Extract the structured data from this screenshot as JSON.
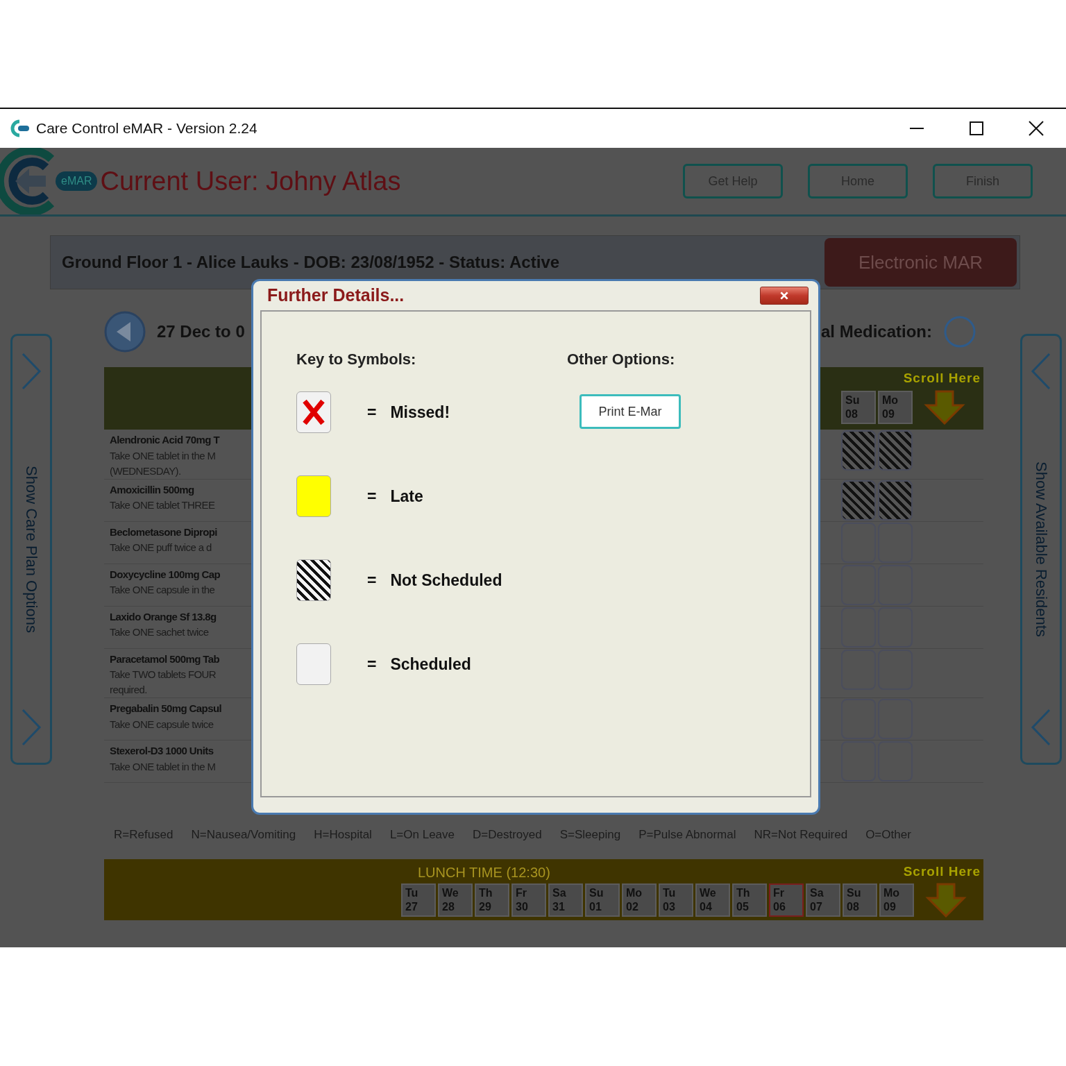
{
  "window": {
    "title": "Care Control eMAR - Version 2.24"
  },
  "header": {
    "badge": "eMAR",
    "current_user": "Current User: Johny Atlas",
    "buttons": [
      "Get Help",
      "Home",
      "Finish"
    ]
  },
  "banner": {
    "text": "Ground Floor 1 - Alice Lauks - DOB: 23/08/1952 - Status: Active",
    "mode_button": "Electronic MAR"
  },
  "left_panel": {
    "label": "Show Care Plan Options"
  },
  "right_panel": {
    "label": "Show Available Residents"
  },
  "date_range": "27 Dec to 0",
  "medication_filter": {
    "label": "al Medication:",
    "checked": false
  },
  "morning_grid": {
    "scroll_label": "Scroll Here",
    "days": [
      {
        "day": "Su",
        "date": "08",
        "selected": false
      },
      {
        "day": "Mo",
        "date": "09",
        "selected": false
      }
    ],
    "medications": [
      {
        "name": "Alendronic Acid 70mg T",
        "lines": [
          "Take ONE tablet in the M",
          "(WEDNESDAY)."
        ],
        "cells": [
          {
            "kind": "not_scheduled"
          },
          {
            "kind": "not_scheduled"
          }
        ]
      },
      {
        "name": "Amoxicillin 500mg",
        "lines": [
          "Take ONE tablet THREE"
        ],
        "cells": [
          {
            "kind": "not_scheduled"
          },
          {
            "kind": "not_scheduled"
          }
        ]
      },
      {
        "name": "Beclometasone Dipropi",
        "lines": [
          "Take ONE puff twice a d"
        ],
        "cells": [
          {
            "kind": "scheduled"
          },
          {
            "kind": "scheduled"
          }
        ]
      },
      {
        "name": "Doxycycline 100mg Cap",
        "lines": [
          "Take ONE capsule in the"
        ],
        "cells": [
          {
            "kind": "scheduled"
          },
          {
            "kind": "scheduled"
          }
        ]
      },
      {
        "name": "Laxido Orange Sf 13.8g",
        "lines": [
          "Take ONE sachet twice"
        ],
        "cells": [
          {
            "kind": "scheduled"
          },
          {
            "kind": "scheduled"
          }
        ]
      },
      {
        "name": "Paracetamol 500mg Tab",
        "lines": [
          "Take TWO tablets FOUR",
          "required."
        ],
        "cells": [
          {
            "kind": "scheduled"
          },
          {
            "kind": "scheduled"
          }
        ]
      },
      {
        "name": "Pregabalin 50mg Capsul",
        "lines": [
          "Take ONE capsule twice"
        ],
        "cells": [
          {
            "kind": "scheduled"
          },
          {
            "kind": "scheduled"
          }
        ]
      },
      {
        "name": "Stexerol-D3 1000 Units",
        "lines": [
          "Take ONE tablet in the M"
        ],
        "cells": [
          {
            "kind": "scheduled"
          },
          {
            "kind": "scheduled"
          }
        ]
      }
    ]
  },
  "legend": [
    "R=Refused",
    "N=Nausea/Vomiting",
    "H=Hospital",
    "L=On Leave",
    "D=Destroyed",
    "S=Sleeping",
    "P=Pulse Abnormal",
    "NR=Not Required",
    "O=Other"
  ],
  "lunch_grid": {
    "title": "LUNCH TIME (12:30)",
    "scroll_label": "Scroll Here",
    "days": [
      {
        "day": "Tu",
        "date": "27",
        "selected": false
      },
      {
        "day": "We",
        "date": "28",
        "selected": false
      },
      {
        "day": "Th",
        "date": "29",
        "selected": false
      },
      {
        "day": "Fr",
        "date": "30",
        "selected": false
      },
      {
        "day": "Sa",
        "date": "31",
        "selected": false
      },
      {
        "day": "Su",
        "date": "01",
        "selected": false
      },
      {
        "day": "Mo",
        "date": "02",
        "selected": false
      },
      {
        "day": "Tu",
        "date": "03",
        "selected": false
      },
      {
        "day": "We",
        "date": "04",
        "selected": false
      },
      {
        "day": "Th",
        "date": "05",
        "selected": false
      },
      {
        "day": "Fr",
        "date": "06",
        "selected": true
      },
      {
        "day": "Sa",
        "date": "07",
        "selected": false
      },
      {
        "day": "Su",
        "date": "08",
        "selected": false
      },
      {
        "day": "Mo",
        "date": "09",
        "selected": false
      }
    ]
  },
  "dialog": {
    "title": "Further Details...",
    "key_heading": "Key to Symbols:",
    "options_heading": "Other Options:",
    "symbols": [
      {
        "kind": "missed",
        "sign": "=",
        "label": "Missed!"
      },
      {
        "kind": "late",
        "sign": "=",
        "label": "Late"
      },
      {
        "kind": "not_scheduled",
        "sign": "=",
        "label": "Not Scheduled"
      },
      {
        "kind": "scheduled",
        "sign": "=",
        "label": "Scheduled"
      }
    ],
    "buttons": [
      "Print E-Mar"
    ]
  }
}
